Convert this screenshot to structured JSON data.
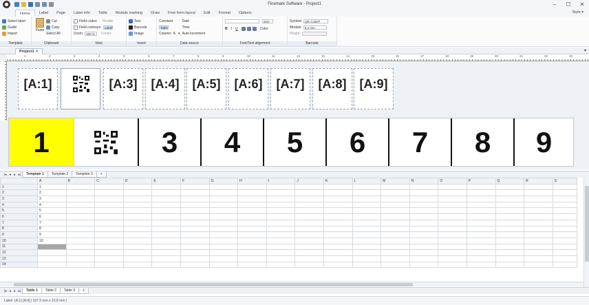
{
  "window": {
    "title": "Finemark Software - Project1",
    "min_label": "–",
    "max_label": "☐",
    "close_label": "✕"
  },
  "menu": {
    "tabs": [
      "Home",
      "Label",
      "Page",
      "Label info",
      "Table",
      "Module marking",
      "Draw",
      "Free form layout",
      "Edit",
      "Format",
      "Options"
    ],
    "style_label": "Style ▾"
  },
  "ribbon": {
    "template": {
      "select_label": "Select label",
      "guide": "Guide",
      "import": "Import",
      "group": "Template"
    },
    "clipboard": {
      "paste": "Paste",
      "cut": "Cut",
      "copy": "Copy",
      "select_all": "Select All",
      "group": "Clipboard"
    },
    "view": {
      "field_codes": "Field codes",
      "field_contours": "Field contours",
      "zoom_label": "Zoom:",
      "zoom_value": "200 %",
      "header": "Header",
      "label": "Label",
      "footer": "Footer",
      "group": "View"
    },
    "insert": {
      "text": "Text",
      "barcode": "Barcode",
      "image": "Image",
      "group": "Insert"
    },
    "data_source": {
      "constant": "Constant",
      "table": "Table",
      "column_label": "Column:",
      "column_value": "A",
      "date": "Date",
      "time": "Time",
      "auto_increment": "Auto increment",
      "group": "Data source"
    },
    "font": {
      "size_label": "Size",
      "bold": "B",
      "italic": "I",
      "underline": "U",
      "color": "Color",
      "group": "Font/Text alignment"
    },
    "barcode": {
      "symbol_label": "Symbol:",
      "symbol_value": "QR Code®",
      "module_label": "Module:",
      "module_value": "0,4 mm",
      "height_label": "Height:",
      "group": "Barcode"
    }
  },
  "document": {
    "tab": "Project1",
    "close": "✕"
  },
  "ruler": {
    "numbers": [
      "1",
      "2",
      "3",
      "4",
      "5",
      "6",
      "7",
      "8",
      "9",
      "10",
      "11",
      "12",
      "13",
      "14",
      "15",
      "16",
      "17",
      "18",
      "19",
      "20",
      "21",
      "22",
      "23"
    ]
  },
  "labels": [
    "[A:1]",
    "",
    "[A:3]",
    "[A:4]",
    "[A:5]",
    "[A:6]",
    "[A:7]",
    "[A:8]",
    "[A:9]"
  ],
  "preview": [
    "1",
    "",
    "3",
    "4",
    "5",
    "6",
    "7",
    "8",
    "9"
  ],
  "template_tabs": [
    "Template 1",
    "Template 2",
    "Template 3"
  ],
  "sheet": {
    "columns": [
      "A",
      "B",
      "C",
      "D",
      "E",
      "F",
      "G",
      "H",
      "I",
      "J",
      "K",
      "L",
      "M",
      "N",
      "O",
      "P",
      "Q",
      "R",
      "S"
    ],
    "rows": [
      "1",
      "2",
      "3",
      "4",
      "5",
      "6",
      "7",
      "8",
      "9",
      "10",
      "11",
      "12",
      "13",
      "14"
    ],
    "col_a": [
      "1",
      "2",
      "3",
      "4",
      "5",
      "6",
      "7",
      "8",
      "9",
      "10",
      "",
      "",
      "",
      ""
    ]
  },
  "table_tabs": [
    "Table 1",
    "Table 2",
    "Table 3"
  ],
  "status": "Label: (A:1) [A:9] | 157.5 mm x 15.8 mm |",
  "colors": {
    "accent_yellow": "#ffff00",
    "selected_gray": "#a6a6a6"
  }
}
